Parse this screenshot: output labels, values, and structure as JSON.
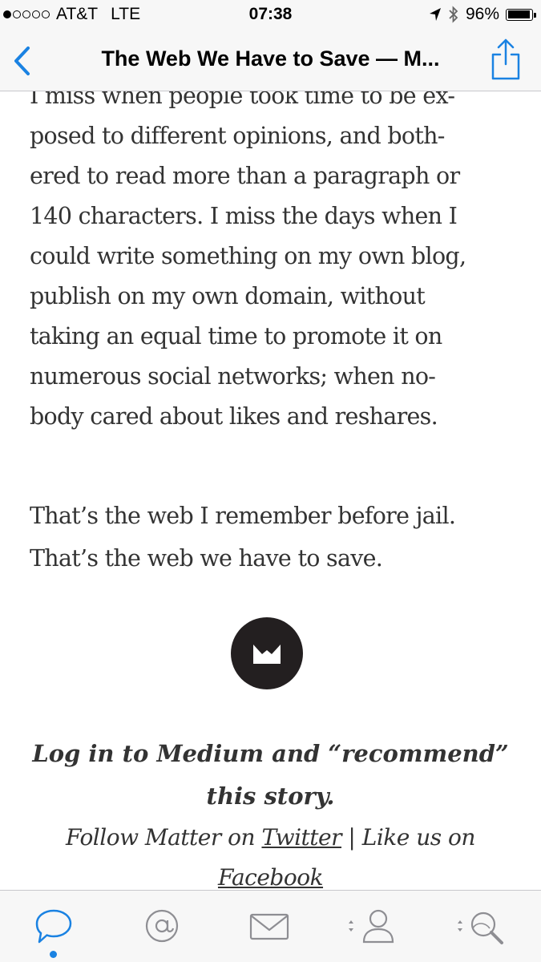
{
  "status_bar": {
    "carrier": "AT&T",
    "network": "LTE",
    "time": "07:38",
    "battery_percent": "96%",
    "battery_level": 0.96,
    "signal_bars": 1,
    "icons": [
      "location-arrow-icon",
      "bluetooth-icon",
      "battery-icon"
    ]
  },
  "nav": {
    "title": "The Web We Have to Save — M...",
    "back_icon": "chevron-left-icon",
    "share_icon": "share-icon",
    "accent": "#1a82e2"
  },
  "article": {
    "paragraph1_lines": [
      "I miss when people took time to be ex-",
      "posed to different opinions, and both-",
      "ered to read more than a paragraph or",
      "140 characters. I miss the days when I",
      "could write something on my own blog,",
      "publish on my own domain, without",
      "taking an equal time to promote it on",
      "numerous social networks; when no-",
      "body cared about likes and reshares."
    ],
    "paragraph2_lines": [
      "That’s the web I remember before jail.",
      "That’s the web we have to save."
    ],
    "logo_icon": "medium-logo-icon"
  },
  "cta": {
    "bold_lines": [
      "Log in to Medium and “recommend”",
      "this story."
    ],
    "follow_prefix": "Follow Matter on ",
    "twitter_link": "Twitter",
    "separator": " | Like us on",
    "facebook_link": "Facebook"
  },
  "tab_bar": {
    "tabs": [
      {
        "icon": "speech-bubble-icon",
        "active": true
      },
      {
        "icon": "at-sign-icon",
        "active": false
      },
      {
        "icon": "envelope-icon",
        "active": false
      },
      {
        "icon": "person-icon",
        "active": false
      },
      {
        "icon": "search-icon",
        "active": false
      }
    ],
    "active_color": "#1a82e2",
    "inactive_color": "#8e8e93"
  }
}
